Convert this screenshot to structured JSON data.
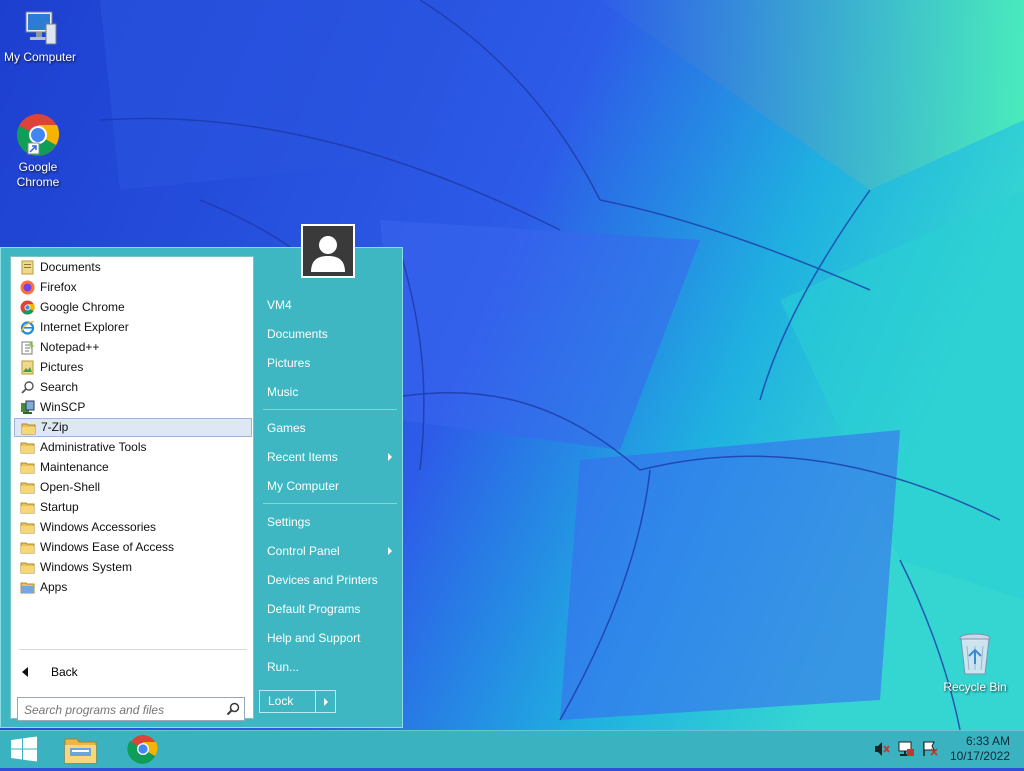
{
  "desktop": {
    "icons": [
      {
        "label": "My Computer",
        "icon": "monitor-icon"
      },
      {
        "label": "Google Chrome",
        "icon": "chrome-icon"
      },
      {
        "label": "Recycle Bin",
        "icon": "recycle-bin-icon"
      }
    ]
  },
  "start_menu": {
    "programs": [
      {
        "label": "Documents",
        "icon": "documents-icon"
      },
      {
        "label": "Firefox",
        "icon": "firefox-icon"
      },
      {
        "label": "Google Chrome",
        "icon": "chrome-icon"
      },
      {
        "label": "Internet Explorer",
        "icon": "internet-explorer-icon"
      },
      {
        "label": "Notepad++",
        "icon": "notepadpp-icon"
      },
      {
        "label": "Pictures",
        "icon": "pictures-icon"
      },
      {
        "label": "Search",
        "icon": "search-icon"
      },
      {
        "label": "WinSCP",
        "icon": "winscp-icon"
      },
      {
        "label": "7-Zip",
        "icon": "folder-icon",
        "selected": true
      },
      {
        "label": "Administrative Tools",
        "icon": "folder-icon"
      },
      {
        "label": "Maintenance",
        "icon": "folder-icon"
      },
      {
        "label": "Open-Shell",
        "icon": "folder-icon"
      },
      {
        "label": "Startup",
        "icon": "folder-icon"
      },
      {
        "label": "Windows Accessories",
        "icon": "folder-icon"
      },
      {
        "label": "Windows Ease of Access",
        "icon": "folder-icon"
      },
      {
        "label": "Windows System",
        "icon": "folder-icon"
      },
      {
        "label": "Apps",
        "icon": "apps-folder-icon"
      }
    ],
    "back_label": "Back",
    "search_placeholder": "Search programs and files",
    "right_items": [
      {
        "label": "VM4"
      },
      {
        "label": "Documents"
      },
      {
        "label": "Pictures"
      },
      {
        "label": "Music"
      },
      {
        "label": "Games"
      },
      {
        "label": "Recent Items",
        "submenu": true
      },
      {
        "label": "My Computer"
      },
      {
        "label": "Settings"
      },
      {
        "label": "Control Panel",
        "submenu": true
      },
      {
        "label": "Devices and Printers"
      },
      {
        "label": "Default Programs"
      },
      {
        "label": "Help and Support"
      },
      {
        "label": "Run..."
      }
    ],
    "lock_label": "Lock"
  },
  "taskbar": {
    "items": [
      "start-button",
      "file-explorer-icon",
      "chrome-icon"
    ],
    "tray": [
      "volume-muted-icon",
      "network-icon",
      "action-center-icon"
    ],
    "time": "6:33 AM",
    "date": "10/17/2022"
  },
  "colors": {
    "menu_bg": "#3fb7c2",
    "taskbar_bg": "#3ab2bf",
    "selection": "#dde8f4"
  }
}
